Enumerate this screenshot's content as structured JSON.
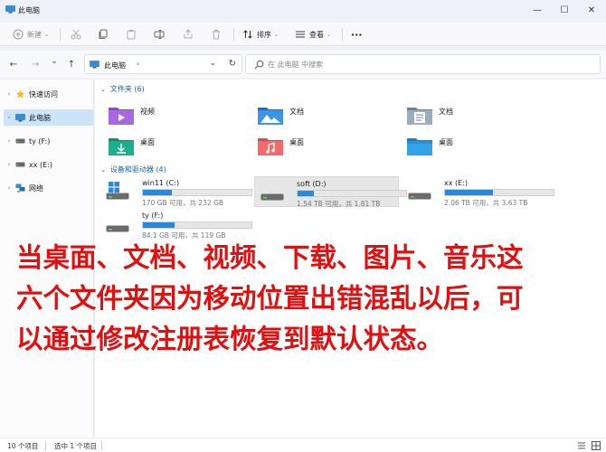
{
  "window": {
    "title": "此电脑",
    "minimize": "—",
    "maximize": "☐",
    "close": "✕"
  },
  "toolbar": {
    "new_label": "新建",
    "sort_label": "排序",
    "view_label": "查看",
    "more_label": "···"
  },
  "address": {
    "crumb": "此电脑",
    "separator": "›",
    "dropdown": "⌄",
    "refresh": "↻"
  },
  "search": {
    "placeholder": "在 此电脑 中搜索"
  },
  "nav": {
    "back": "←",
    "forward": "→",
    "dropdown": "⌄",
    "up": "↑",
    "items": [
      {
        "label": "快速访问",
        "icon": "star-icon"
      },
      {
        "label": "此电脑",
        "icon": "pc-icon",
        "selected": true
      },
      {
        "label": "ty (F:)",
        "icon": "drive-icon"
      },
      {
        "label": "xx (E:)",
        "icon": "drive-icon"
      },
      {
        "label": "网络",
        "icon": "network-icon"
      }
    ]
  },
  "folders_section": {
    "label": "文件夹 (6)"
  },
  "folders": [
    {
      "name": "视频",
      "icon": "videos-folder-icon"
    },
    {
      "name": "文档",
      "icon": "documents-folder-icon"
    },
    {
      "name": "文档",
      "icon": "documents-folder-icon"
    },
    {
      "name": "桌面",
      "icon": "downloads-folder-icon"
    },
    {
      "name": "桌面",
      "icon": "music-folder-icon"
    },
    {
      "name": "桌面",
      "icon": "desktop-folder-icon"
    }
  ],
  "drives_section": {
    "label": "设备和驱动器 (4)"
  },
  "drives": [
    {
      "name": "win11 (C:)",
      "size": "170 GB 可用，共 232 GB",
      "used_fraction": 0.27,
      "icon": "windows-drive-icon",
      "selected": false
    },
    {
      "name": "soft (D:)",
      "size": "1.54 TB 可用，共 1.81 TB",
      "used_fraction": 0.15,
      "icon": "drive-icon",
      "selected": true
    },
    {
      "name": "xx (E:)",
      "size": "2.06 TB 可用，共 3.63 TB",
      "used_fraction": 0.44,
      "icon": "drive-icon",
      "selected": false
    },
    {
      "name": "ty (F:)",
      "size": "84.1 GB 可用，共 119 GB",
      "used_fraction": 0.29,
      "icon": "drive-icon",
      "selected": false
    }
  ],
  "overlay_text": [
    "当桌面、文档、视频、下载、图片、音乐这",
    "六个文件夹因为移动位置出错混乱以后，可",
    "以通过修改注册表恢复到默认状态。"
  ],
  "status": {
    "count": "10 个项目",
    "selected": "选中 1 个项目"
  },
  "colors": {
    "accent": "#2b88d8",
    "overlay": "#e01010",
    "selected_nav": "#cce4f7"
  }
}
